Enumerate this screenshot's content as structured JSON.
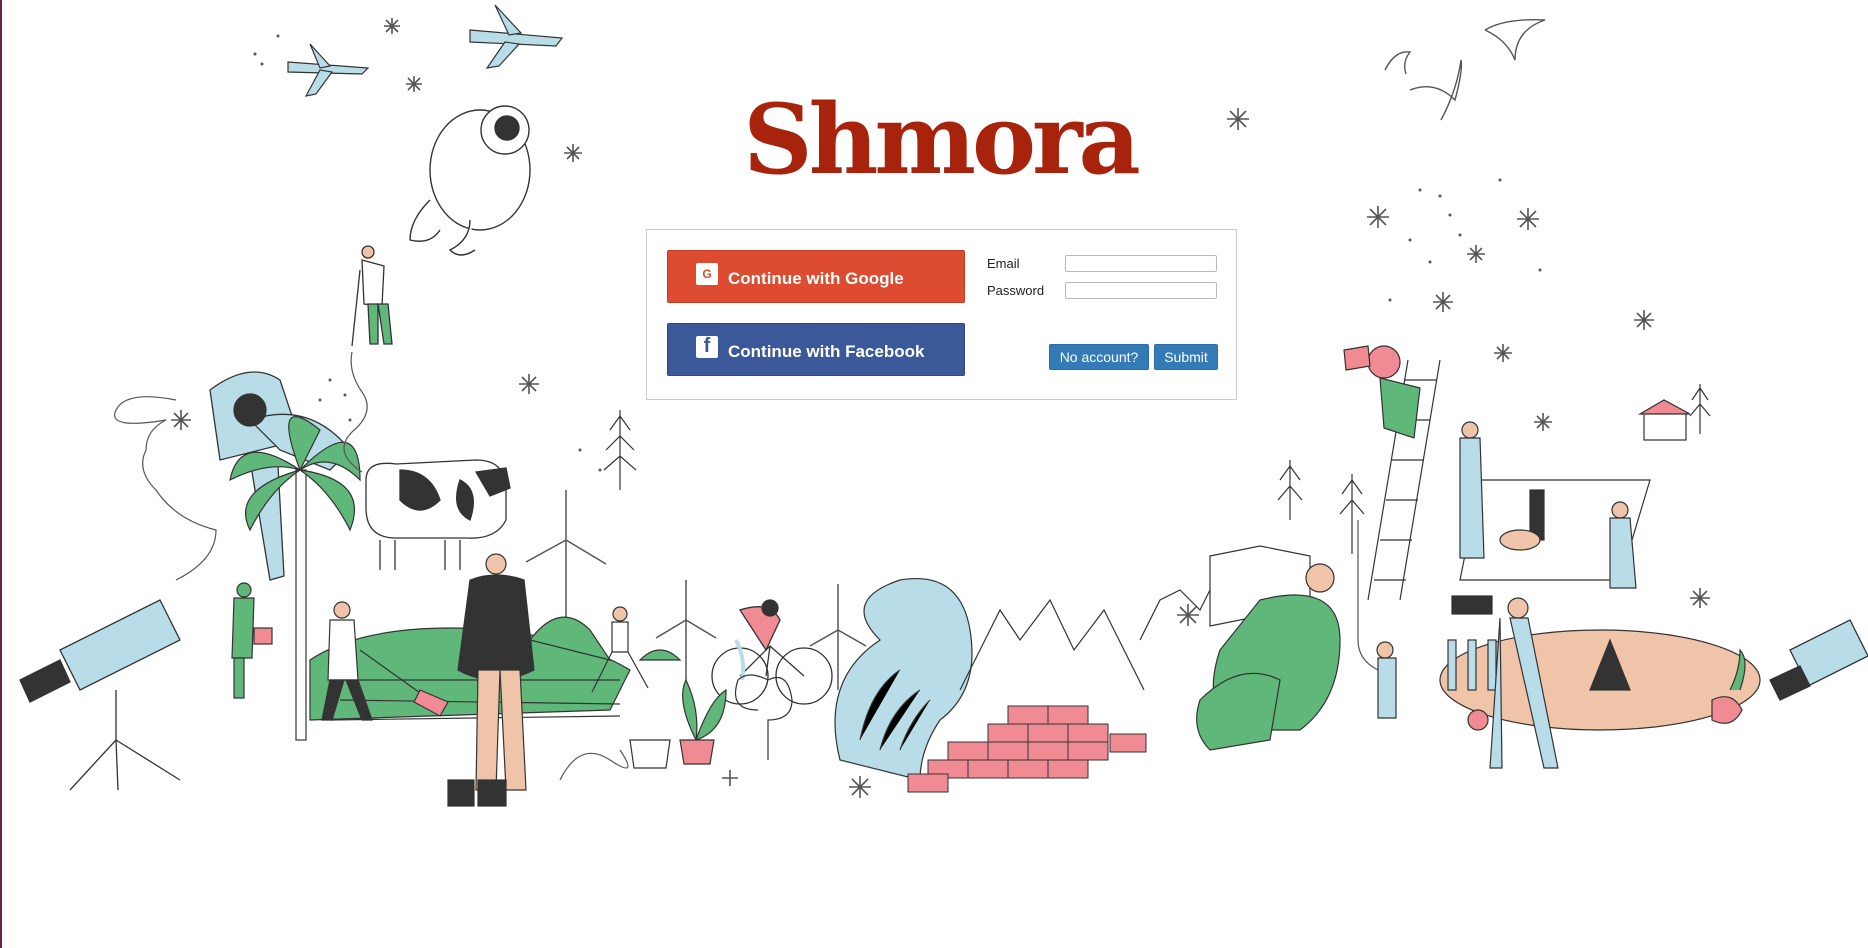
{
  "app": {
    "logo_text": "Shmora"
  },
  "social_login": {
    "google_label": "Continue with Google",
    "google_icon": "google-icon",
    "google_icon_glyph": "G",
    "google_color": "#dd4b30",
    "facebook_label": "Continue with Facebook",
    "facebook_icon": "facebook-icon",
    "facebook_icon_glyph": "f",
    "facebook_color": "#3b5998"
  },
  "form": {
    "email_label": "Email",
    "email_value": "",
    "password_label": "Password",
    "password_value": ""
  },
  "actions": {
    "no_account_label": "No account?",
    "submit_label": "Submit",
    "button_color": "#337ab7"
  },
  "colors": {
    "brand": "#a8230c",
    "illustration_blue": "#b9dde8",
    "illustration_green": "#5fb87a",
    "illustration_pink": "#f08a93",
    "illustration_peach": "#efc4a8"
  }
}
